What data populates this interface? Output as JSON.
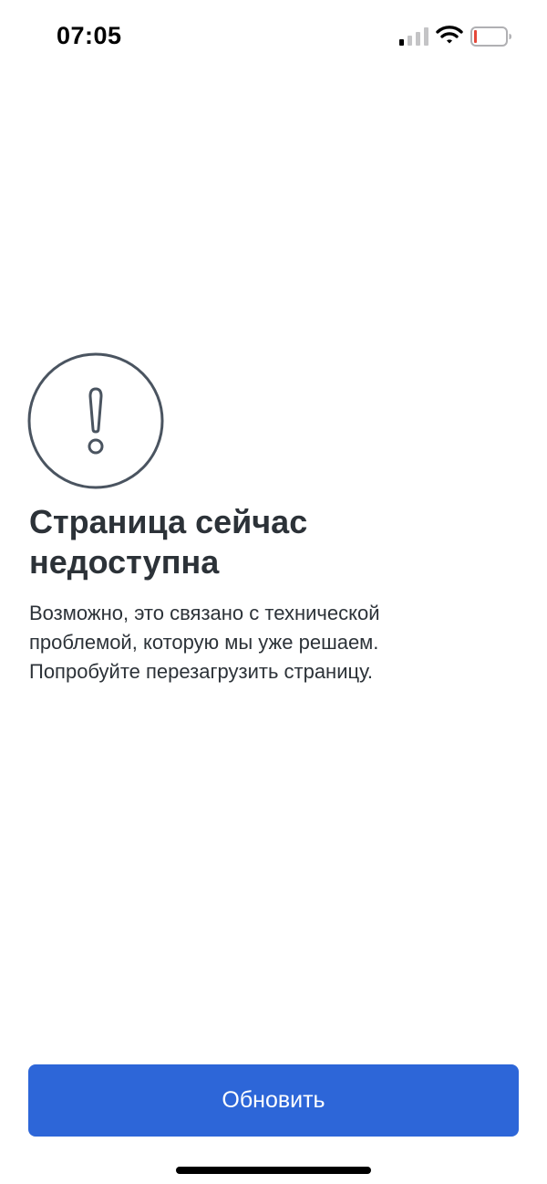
{
  "status_bar": {
    "time": "07:05",
    "signal_icon": "cellular-signal-icon",
    "wifi_icon": "wifi-icon",
    "battery_icon": "battery-low-icon",
    "battery_accent": "#e5483a"
  },
  "error": {
    "icon": "exclamation-circle-icon",
    "title": "Страница сейчас недоступна",
    "description": "Возможно, это связано с технической проблемой, которую мы уже решаем. Попробуйте перезагрузить страницу."
  },
  "actions": {
    "refresh_label": "Обновить"
  },
  "colors": {
    "accent": "#2d66d8",
    "text": "#2c3238",
    "icon_stroke": "#4a5460"
  }
}
